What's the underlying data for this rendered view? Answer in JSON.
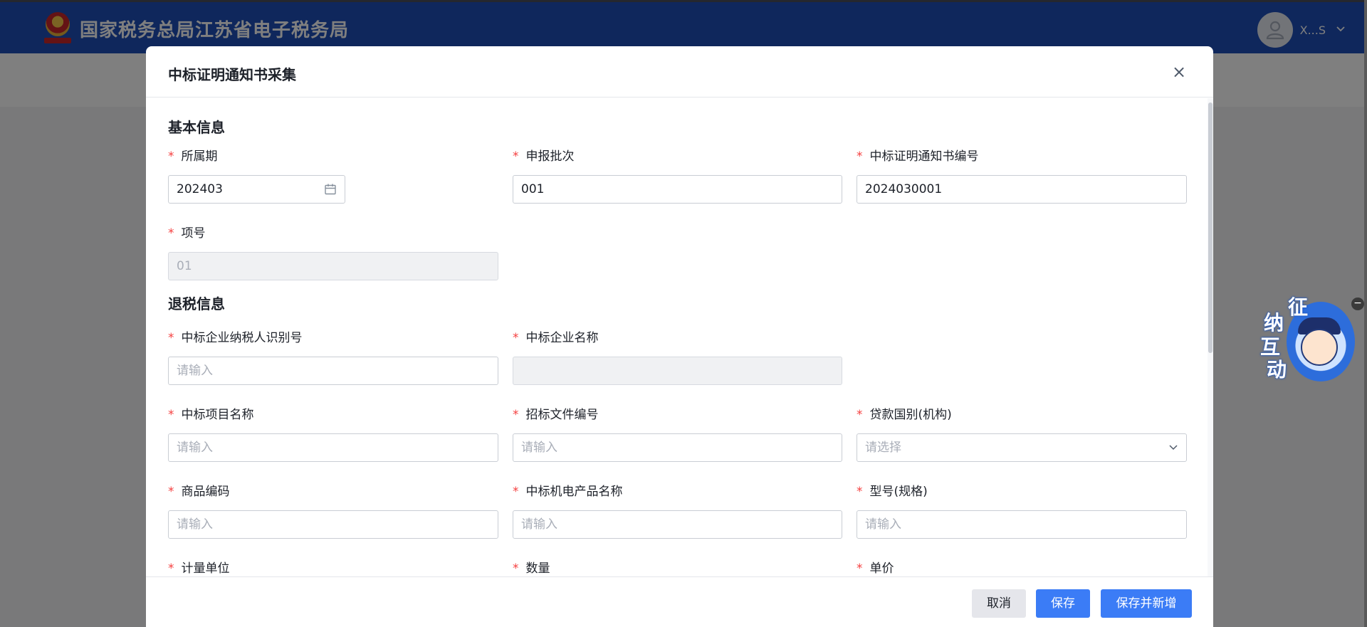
{
  "app": {
    "title": "国家税务总局江苏省电子税务局",
    "user_name": "X...S"
  },
  "dialog": {
    "title": "中标证明通知书采集",
    "close_label": "×"
  },
  "sections": {
    "basic": "基本信息",
    "refund": "退税信息"
  },
  "fields": {
    "period": {
      "label": "所属期",
      "value": "202403"
    },
    "batch": {
      "label": "申报批次",
      "value": "001"
    },
    "notice_no": {
      "label": "中标证明通知书编号",
      "value": "2024030001"
    },
    "item_no": {
      "label": "项号",
      "value": "01"
    },
    "taxpayer_id": {
      "label": "中标企业纳税人识别号",
      "placeholder": "请输入"
    },
    "company_name": {
      "label": "中标企业名称",
      "value": ""
    },
    "project_name": {
      "label": "中标项目名称",
      "placeholder": "请输入"
    },
    "tender_doc_no": {
      "label": "招标文件编号",
      "placeholder": "请输入"
    },
    "loan_country": {
      "label": "贷款国别(机构)",
      "placeholder": "请选择"
    },
    "goods_code": {
      "label": "商品编码",
      "placeholder": "请输入"
    },
    "product_name": {
      "label": "中标机电产品名称",
      "placeholder": "请输入"
    },
    "model": {
      "label": "型号(规格)",
      "placeholder": "请输入"
    },
    "unit": {
      "label": "计量单位"
    },
    "quantity": {
      "label": "数量"
    },
    "price": {
      "label": "单价"
    }
  },
  "required_mark": "*",
  "footer": {
    "cancel": "取消",
    "save": "保存",
    "save_new": "保存并新增"
  },
  "assistant": {
    "chars": [
      "征",
      "纳",
      "互",
      "动"
    ],
    "close": "−"
  },
  "colors": {
    "header_bg": "#1f4fb8",
    "primary": "#3b7cf6",
    "required": "#f53f3f"
  }
}
